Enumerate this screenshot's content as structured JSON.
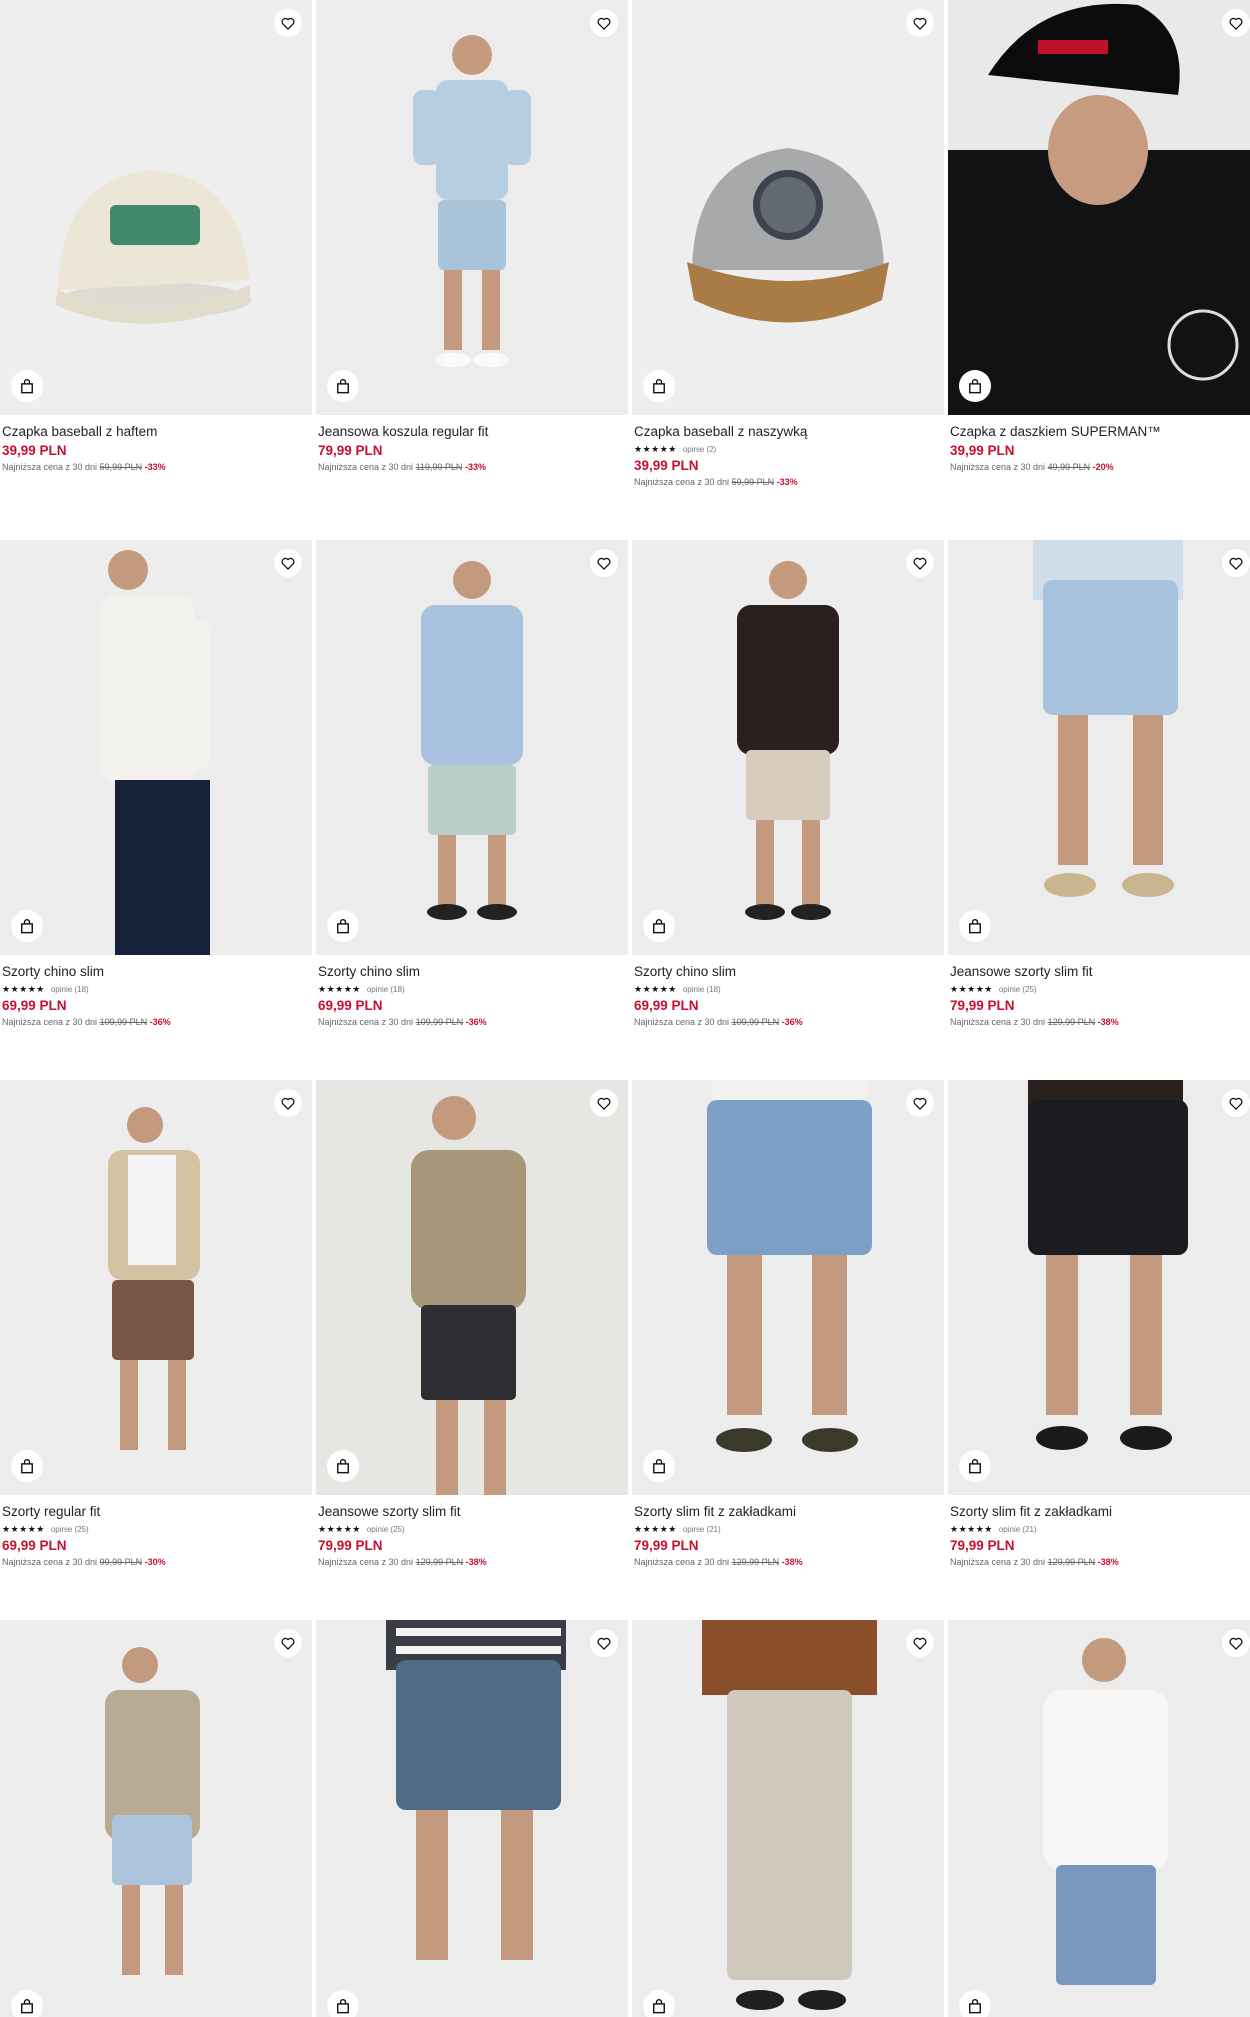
{
  "colors": {
    "price": "#c8102e",
    "text": "#222222",
    "photo_bg": "#eeeeee"
  },
  "icons": {
    "favorite": "heart-icon",
    "add_to_cart": "shopping-bag-icon",
    "rating": "star-icon"
  },
  "products": [
    {
      "name": "Czapka baseball z haftem",
      "rating": null,
      "reviews": null,
      "price": "39,99 PLN",
      "lowest_label": "Najniższa cena z 30 dni",
      "old_price": "59,99 PLN",
      "discount": "-33%",
      "photo_tone": "#efeeee"
    },
    {
      "name": "Jeansowa koszula regular fit",
      "rating": null,
      "reviews": null,
      "price": "79,99 PLN",
      "lowest_label": "Najniższa cena z 30 dni",
      "old_price": "119,99 PLN",
      "discount": "-33%",
      "photo_tone": "#ececec"
    },
    {
      "name": "Czapka baseball z naszywką",
      "rating": "★★★★★",
      "reviews": "opinie (2)",
      "price": "39,99 PLN",
      "lowest_label": "Najniższa cena z 30 dni",
      "old_price": "59,99 PLN",
      "discount": "-33%",
      "photo_tone": "#efeeee"
    },
    {
      "name": "Czapka z daszkiem SUPERMAN™",
      "rating": null,
      "reviews": null,
      "price": "39,99 PLN",
      "lowest_label": "Najniższa cena z 30 dni",
      "old_price": "49,99 PLN",
      "discount": "-20%",
      "photo_tone": "#e9e9ea"
    },
    {
      "name": "Szorty chino slim",
      "rating": "★★★★★",
      "reviews": "opinie (18)",
      "price": "69,99 PLN",
      "lowest_label": "Najniższa cena z 30 dni",
      "old_price": "109,99 PLN",
      "discount": "-36%",
      "photo_tone": "#ededed"
    },
    {
      "name": "Szorty chino slim",
      "rating": "★★★★★",
      "reviews": "opinie (18)",
      "price": "69,99 PLN",
      "lowest_label": "Najniższa cena z 30 dni",
      "old_price": "109,99 PLN",
      "discount": "-36%",
      "photo_tone": "#ececec"
    },
    {
      "name": "Szorty chino slim",
      "rating": "★★★★★",
      "reviews": "opinie (18)",
      "price": "69,99 PLN",
      "lowest_label": "Najniższa cena z 30 dni",
      "old_price": "109,99 PLN",
      "discount": "-36%",
      "photo_tone": "#ededed"
    },
    {
      "name": "Jeansowe szorty slim fit",
      "rating": "★★★★★",
      "reviews": "opinie (25)",
      "price": "79,99 PLN",
      "lowest_label": "Najniższa cena z 30 dni",
      "old_price": "129,99 PLN",
      "discount": "-38%",
      "photo_tone": "#ececec"
    },
    {
      "name": "Szorty regular fit",
      "rating": "★★★★★",
      "reviews": "opinie (25)",
      "price": "69,99 PLN",
      "lowest_label": "Najniższa cena z 30 dni",
      "old_price": "99,99 PLN",
      "discount": "-30%",
      "photo_tone": "#ededed"
    },
    {
      "name": "Jeansowe szorty slim fit",
      "rating": "★★★★★",
      "reviews": "opinie (25)",
      "price": "79,99 PLN",
      "lowest_label": "Najniższa cena z 30 dni",
      "old_price": "129,99 PLN",
      "discount": "-38%",
      "photo_tone": "#e6e6e3"
    },
    {
      "name": "Szorty slim fit z zakładkami",
      "rating": "★★★★★",
      "reviews": "opinie (21)",
      "price": "79,99 PLN",
      "lowest_label": "Najniższa cena z 30 dni",
      "old_price": "129,99 PLN",
      "discount": "-38%",
      "photo_tone": "#ededed"
    },
    {
      "name": "Szorty slim fit z zakładkami",
      "rating": "★★★★★",
      "reviews": "opinie (21)",
      "price": "79,99 PLN",
      "lowest_label": "Najniższa cena z 30 dni",
      "old_price": "129,99 PLN",
      "discount": "-38%",
      "photo_tone": "#ececec"
    },
    {
      "name": "",
      "rating": null,
      "reviews": null,
      "price": "",
      "lowest_label": "",
      "old_price": "",
      "discount": "",
      "photo_tone": "#ededed"
    },
    {
      "name": "",
      "rating": null,
      "reviews": null,
      "price": "",
      "lowest_label": "",
      "old_price": "",
      "discount": "",
      "photo_tone": "#ececec"
    },
    {
      "name": "",
      "rating": null,
      "reviews": null,
      "price": "",
      "lowest_label": "",
      "old_price": "",
      "discount": "",
      "photo_tone": "#ededed"
    },
    {
      "name": "",
      "rating": null,
      "reviews": null,
      "price": "",
      "lowest_label": "",
      "old_price": "",
      "discount": "",
      "photo_tone": "#ececec"
    }
  ]
}
